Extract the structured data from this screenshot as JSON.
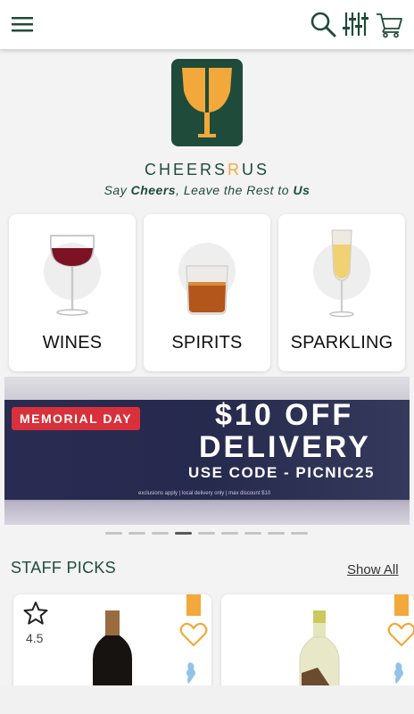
{
  "header": {
    "menu_icon": "hamburger-menu-icon",
    "search_icon": "search-icon",
    "filter_icon": "filter-sliders-icon",
    "cart_icon": "shopping-cart-icon"
  },
  "brand": {
    "logo_icon": "cheers-glasses-logo",
    "name_prefix": "CHEERS",
    "name_r": "R",
    "name_suffix": "US",
    "tagline_say": "Say ",
    "tagline_cheers": "Cheers",
    "tagline_mid": ", Leave the Rest to ",
    "tagline_us": "Us",
    "colors": {
      "primary": "#1f4b3a",
      "accent": "#f2a83b"
    }
  },
  "categories": [
    {
      "label": "WINES",
      "icon": "wine-glass-icon"
    },
    {
      "label": "SPIRITS",
      "icon": "whiskey-glass-icon"
    },
    {
      "label": "SPARKLING",
      "icon": "champagne-flute-icon"
    }
  ],
  "banner": {
    "pill": "MEMORIAL DAY",
    "line1": "$10 OFF",
    "line2": "DELIVERY",
    "code": "USE CODE - PICNIC25",
    "fine_print": "exclusions apply | local delivery only | max discount $10"
  },
  "carousel": {
    "count": 9,
    "active_index": 3
  },
  "staff_picks": {
    "title": "STAFF PICKS",
    "show_all": "Show All",
    "products": [
      {
        "rating": "4.5",
        "bottle": "red-wine-bottle"
      },
      {
        "rating": "",
        "bottle": "white-wine-bottle"
      }
    ]
  }
}
